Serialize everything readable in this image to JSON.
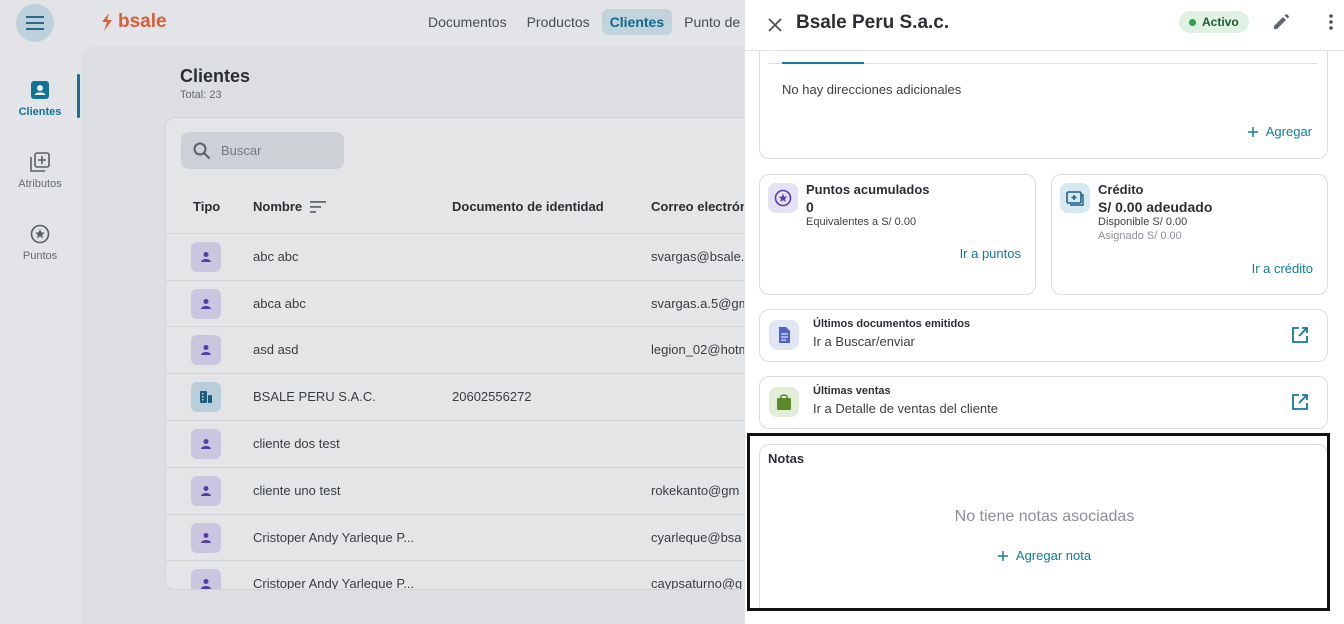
{
  "app": {
    "brand": "bsale",
    "nav": [
      "Documentos",
      "Productos",
      "Clientes",
      "Punto de ver"
    ],
    "nav_active": "Clientes",
    "sidebar": [
      {
        "label": "Clientes",
        "icon": "contacts-icon",
        "active": true
      },
      {
        "label": "Atributos",
        "icon": "add-box-icon",
        "active": false
      },
      {
        "label": "Puntos",
        "icon": "star-circle-icon",
        "active": false
      }
    ]
  },
  "clients_page": {
    "title": "Clientes",
    "total": "Total: 23",
    "search_placeholder": "Buscar",
    "columns": [
      "Tipo",
      "Nombre",
      "Documento de identidad",
      "Correo electrón"
    ],
    "rows": [
      {
        "type": "person",
        "name": "abc abc",
        "document": "",
        "email": "svargas@bsale."
      },
      {
        "type": "person",
        "name": "abca abc",
        "document": "",
        "email": "svargas.a.5@gm"
      },
      {
        "type": "person",
        "name": "asd asd",
        "document": "",
        "email": "legion_02@hotm"
      },
      {
        "type": "business",
        "name": "BSALE PERU S.A.C.",
        "document": "20602556272",
        "email": ""
      },
      {
        "type": "person",
        "name": "cliente dos test",
        "document": "",
        "email": ""
      },
      {
        "type": "person",
        "name": "cliente uno test",
        "document": "",
        "email": "rokekanto@gm"
      },
      {
        "type": "person",
        "name": "Cristoper Andy Yarleque P...",
        "document": "",
        "email": "cyarleque@bsa"
      },
      {
        "type": "person",
        "name": "Cristoper Andy Yarleque P...",
        "document": "",
        "email": "caypsaturno@g"
      }
    ]
  },
  "drawer": {
    "title": "Bsale Peru S.a.c.",
    "status": "Activo",
    "colors": {
      "accent": "#117aa0",
      "status_bg": "#dff2e3",
      "status_dot": "#2fa14a"
    },
    "addresses": {
      "empty_text": "No hay direcciones adicionales",
      "add_label": "Agregar"
    },
    "points": {
      "title": "Puntos acumulados",
      "value": "0",
      "equivalent": "Equivalentes a S/ 0.00",
      "link": "Ir a puntos"
    },
    "credit": {
      "title": "Crédito",
      "value": "S/ 0.00 adeudado",
      "available": "Disponible S/ 0.00",
      "assigned": "Asignado S/ 0.00",
      "link": "Ir a crédito"
    },
    "documents": {
      "title": "Últimos documentos emitidos",
      "subtitle": "Ir a Buscar/enviar"
    },
    "sales": {
      "title": "Últimas ventas",
      "subtitle": "Ir a Detalle de ventas del cliente"
    },
    "notes": {
      "title": "Notas",
      "empty_text": "No tiene notas asociadas",
      "add_label": "Agregar nota"
    }
  }
}
